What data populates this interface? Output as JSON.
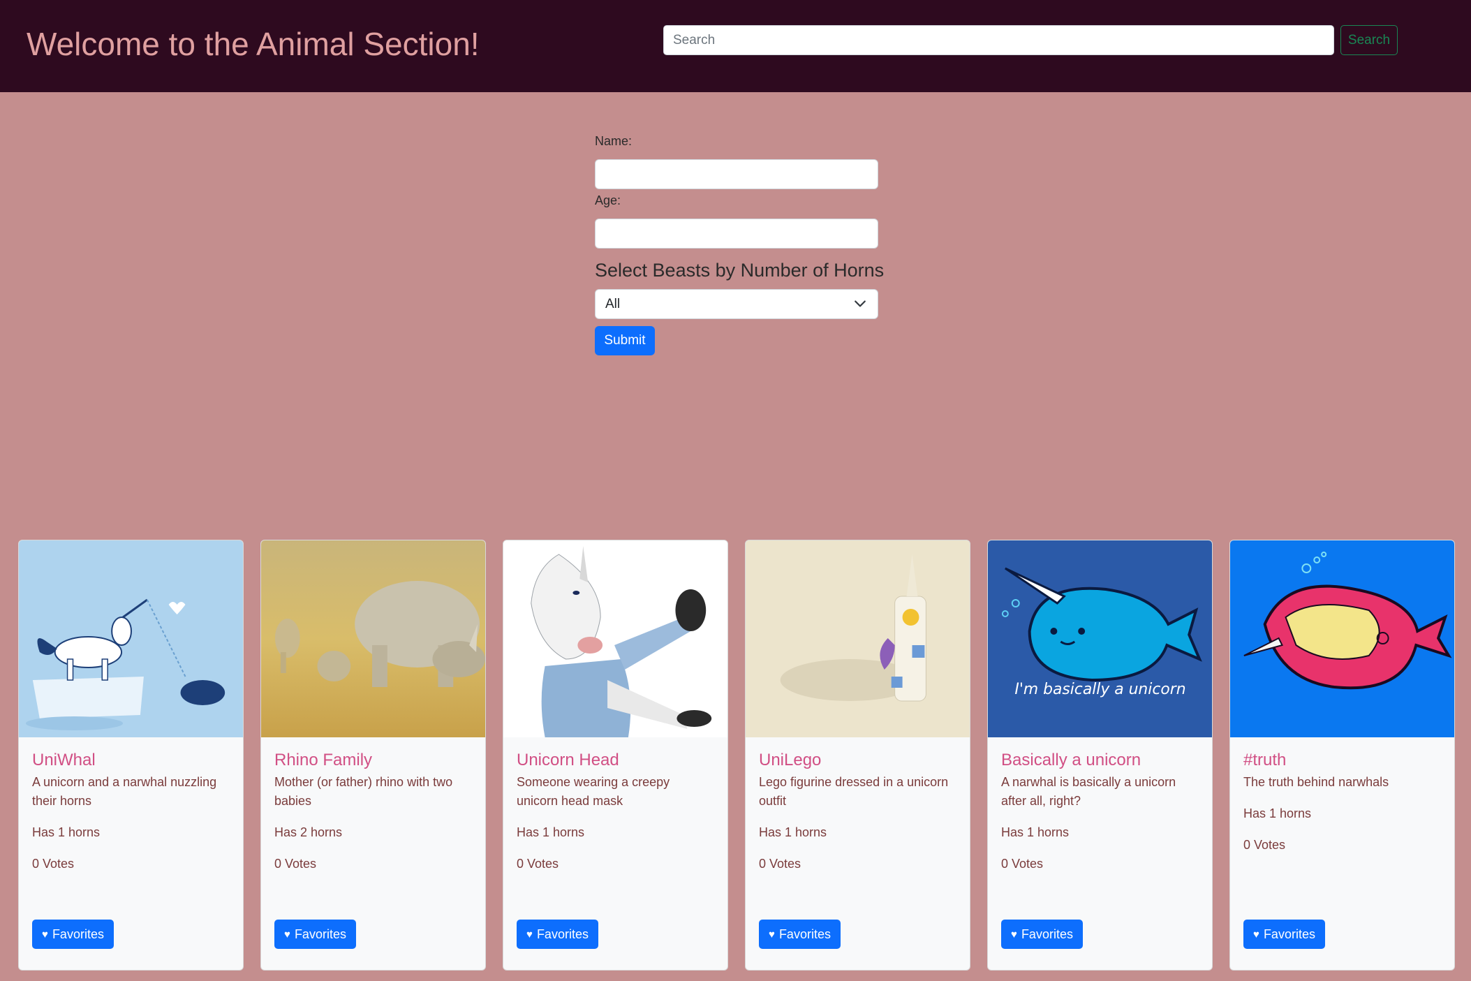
{
  "header": {
    "title": "Welcome to the Animal Section!",
    "search_placeholder": "Search",
    "search_button": "Search"
  },
  "form": {
    "name_label": "Name:",
    "age_label": "Age:",
    "horns_heading": "Select Beasts by Number of Horns",
    "horns_selected": "All",
    "submit_label": "Submit"
  },
  "cards": [
    {
      "title": "UniWhal",
      "description": "A unicorn and a narwhal nuzzling their horns",
      "horns": "Has 1 horns",
      "votes": "0 Votes",
      "button": "Favorites",
      "image": "unicorn-narwhal-illustration"
    },
    {
      "title": "Rhino Family",
      "description": "Mother (or father) rhino with two babies",
      "horns": "Has 2 horns",
      "votes": "0 Votes",
      "button": "Favorites",
      "image": "rhino-family-photo"
    },
    {
      "title": "Unicorn Head",
      "description": "Someone wearing a creepy unicorn head mask",
      "horns": "Has 1 horns",
      "votes": "0 Votes",
      "button": "Favorites",
      "image": "unicorn-mask-photo"
    },
    {
      "title": "UniLego",
      "description": "Lego figurine dressed in a unicorn outfit",
      "horns": "Has 1 horns",
      "votes": "0 Votes",
      "button": "Favorites",
      "image": "lego-unicorn-photo"
    },
    {
      "title": "Basically a unicorn",
      "description": "A narwhal is basically a unicorn after all, right?",
      "horns": "Has 1 horns",
      "votes": "0 Votes",
      "button": "Favorites",
      "image": "narwhal-cartoon",
      "image_text": "I'm basically a unicorn"
    },
    {
      "title": "#truth",
      "description": "The truth behind narwhals",
      "horns": "Has 1 horns",
      "votes": "0 Votes",
      "button": "Favorites",
      "image": "narwhal-truth-drawing"
    }
  ],
  "colors": {
    "page_bg": "#c48e8e",
    "header_bg": "#2e0a1f",
    "title_color": "#e0a0a0",
    "card_title": "#d14f84",
    "card_text": "#7a3b3b",
    "primary_button": "#0d6efd",
    "search_button": "#198754"
  }
}
